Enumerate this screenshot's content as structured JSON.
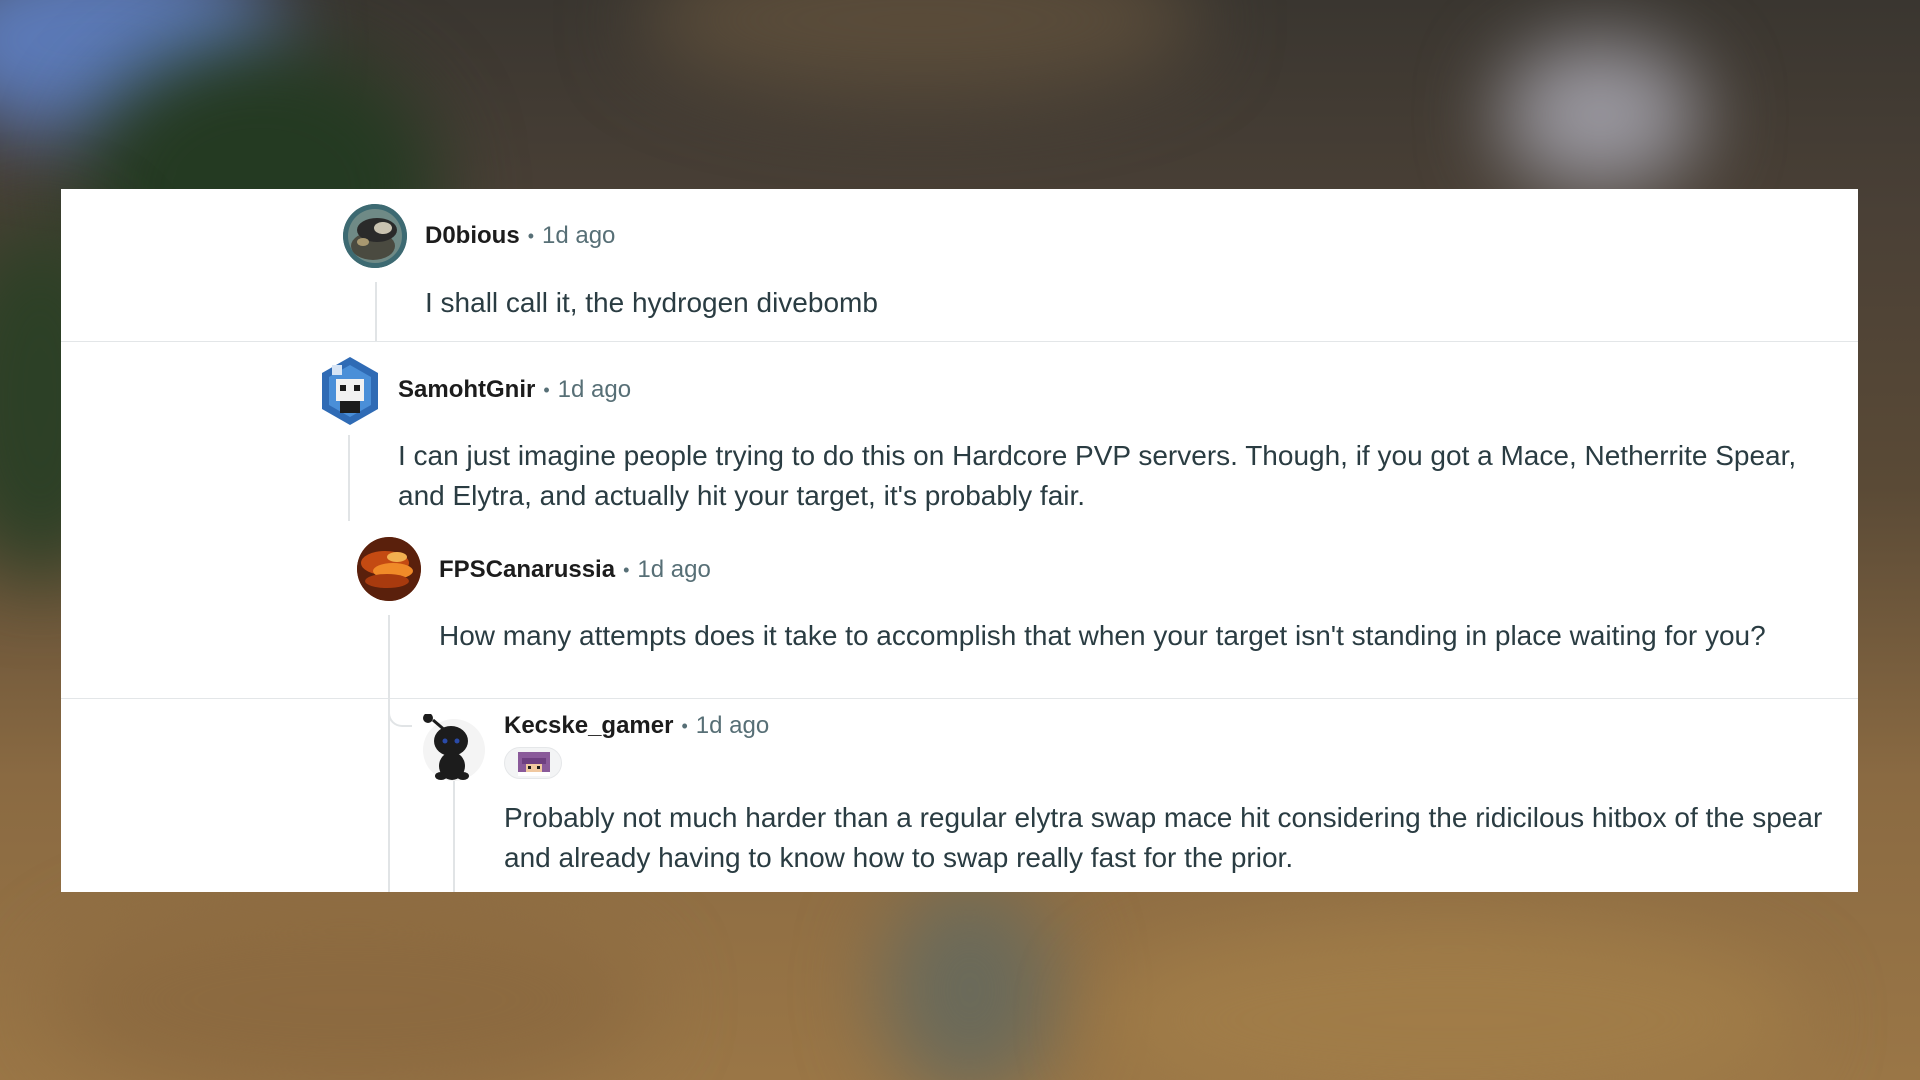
{
  "comments": [
    {
      "author": "D0bious",
      "time": "1d ago",
      "body": "I shall call it, the hydrogen divebomb",
      "avatar_icon": "helmet-avatar-icon"
    },
    {
      "author": "SamohtGnir",
      "time": "1d ago",
      "body": "I can just imagine people trying to do this on Hardcore PVP servers. Though, if you got a Mace, Netherrite Spear, and Elytra, and actually hit your target, it's probably fair.",
      "avatar_icon": "hexagon-character-avatar-icon"
    },
    {
      "author": "FPSCanarussia",
      "time": "1d ago",
      "body": "How many attempts does it take to accomplish that when your target isn't standing in place waiting for you?",
      "avatar_icon": "fire-avatar-icon"
    },
    {
      "author": "Kecske_gamer",
      "time": "1d ago",
      "body": "Probably not much harder than a regular elytra swap mace hit considering the ridicilous hitbox of the spear and already having to know how to swap really fast for the prior.",
      "avatar_icon": "snoo-avatar-icon",
      "flair_icon": "pixel-character-flair-icon"
    }
  ],
  "separator": "•",
  "colors": {
    "panel_bg": "#ffffff",
    "author": "#1c1c1c",
    "meta": "#576f76",
    "body": "#2a3c42",
    "thread_line": "#e1e4e6"
  }
}
